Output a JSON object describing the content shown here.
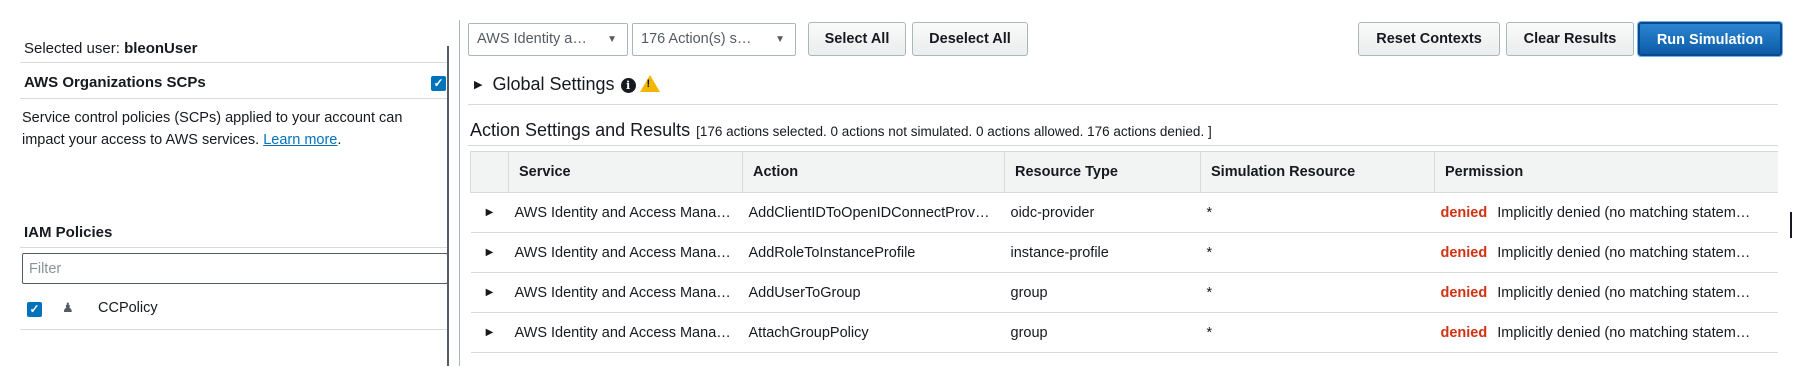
{
  "left": {
    "selected_user_label": "Selected user:",
    "selected_user": "bleonUser",
    "scp_title": "AWS Organizations SCPs",
    "scp_checked": true,
    "scp_desc": "Service control policies (SCPs) applied to your account can impact your access to AWS services.",
    "learn_more": "Learn more",
    "learn_more_suffix": ".",
    "iam_title": "IAM Policies",
    "filter_placeholder": "Filter",
    "policies": [
      {
        "name": "CCPolicy",
        "icon": "user-icon",
        "checked": true
      }
    ]
  },
  "toolbar": {
    "service_dropdown": "AWS Identity a…",
    "actions_dropdown": "176 Action(s) s…",
    "select_all": "Select All",
    "deselect_all": "Deselect All",
    "reset_contexts": "Reset Contexts",
    "clear_results": "Clear Results",
    "run_simulation": "Run Simulation"
  },
  "global_settings": {
    "label": "Global Settings",
    "icons": [
      "info-icon",
      "warning-icon"
    ]
  },
  "results": {
    "title": "Action Settings and Results",
    "summary": "[176 actions selected. 0 actions not simulated. 0 actions allowed. 176 actions denied. ]",
    "columns": [
      "Service",
      "Action",
      "Resource Type",
      "Simulation Resource",
      "Permission"
    ],
    "rows": [
      {
        "service": "AWS Identity and Access Mana…",
        "action": "AddClientIDToOpenIDConnectProv…",
        "resource_type": "oidc-provider",
        "sim_resource": "*",
        "status": "denied",
        "detail": "Implicitly denied (no matching statem…"
      },
      {
        "service": "AWS Identity and Access Mana…",
        "action": "AddRoleToInstanceProfile",
        "resource_type": "instance-profile",
        "sim_resource": "*",
        "status": "denied",
        "detail": "Implicitly denied (no matching statem…"
      },
      {
        "service": "AWS Identity and Access Mana…",
        "action": "AddUserToGroup",
        "resource_type": "group",
        "sim_resource": "*",
        "status": "denied",
        "detail": "Implicitly denied (no matching statem…"
      },
      {
        "service": "AWS Identity and Access Mana…",
        "action": "AttachGroupPolicy",
        "resource_type": "group",
        "sim_resource": "*",
        "status": "denied",
        "detail": "Implicitly denied (no matching statem…"
      }
    ]
  },
  "colors": {
    "accent": "#0073bb",
    "primary_button": "#0d5ca8",
    "denied": "#d13212",
    "warning": "#f2b705"
  }
}
